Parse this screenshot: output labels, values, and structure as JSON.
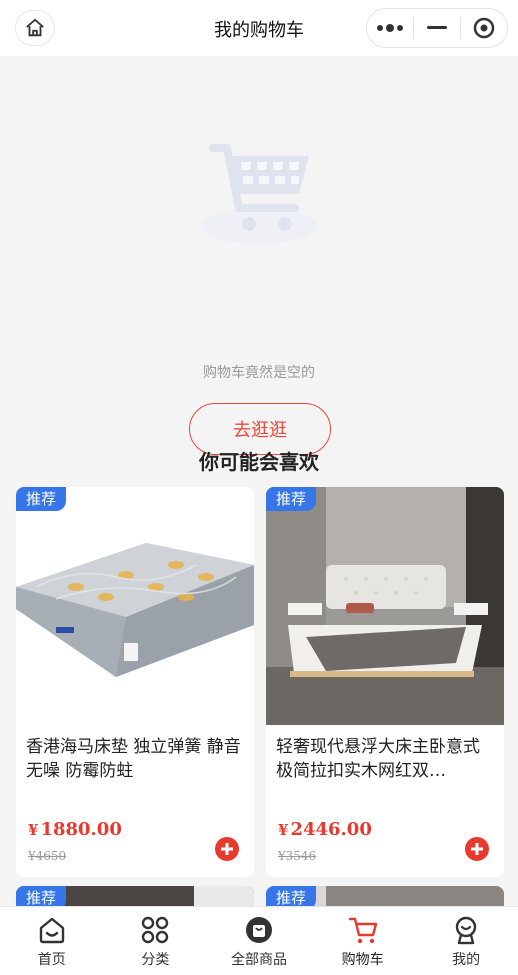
{
  "header": {
    "title": "我的购物车",
    "icons": [
      "home-icon",
      "more-icon",
      "minimize-icon",
      "close-target-icon"
    ]
  },
  "empty_state": {
    "message": "购物车竟然是空的",
    "button_label": "去逛逛",
    "illustration": "shopping-cart-icon"
  },
  "recommend": {
    "title": "你可能会喜欢",
    "badge": "推荐",
    "products": [
      {
        "name": "香港海马床垫 独立弹簧 静音无噪 防霉防蛀",
        "currency": "¥",
        "price": "1880.00",
        "original_price": "¥4650"
      },
      {
        "name": "轻奢现代悬浮大床主卧意式极简拉扣实木网红双…",
        "currency": "¥",
        "price": "2446.00",
        "original_price": "¥3546"
      }
    ]
  },
  "tabbar": {
    "items": [
      {
        "label": "首页",
        "icon": "home-icon"
      },
      {
        "label": "分类",
        "icon": "category-icon"
      },
      {
        "label": "全部商品",
        "icon": "bag-icon"
      },
      {
        "label": "购物车",
        "icon": "cart-icon"
      },
      {
        "label": "我的",
        "icon": "user-icon"
      }
    ],
    "active_index": 3
  },
  "colors": {
    "accent": "#e8392e",
    "badge": "#3776e8",
    "background": "#f4f4f4"
  }
}
